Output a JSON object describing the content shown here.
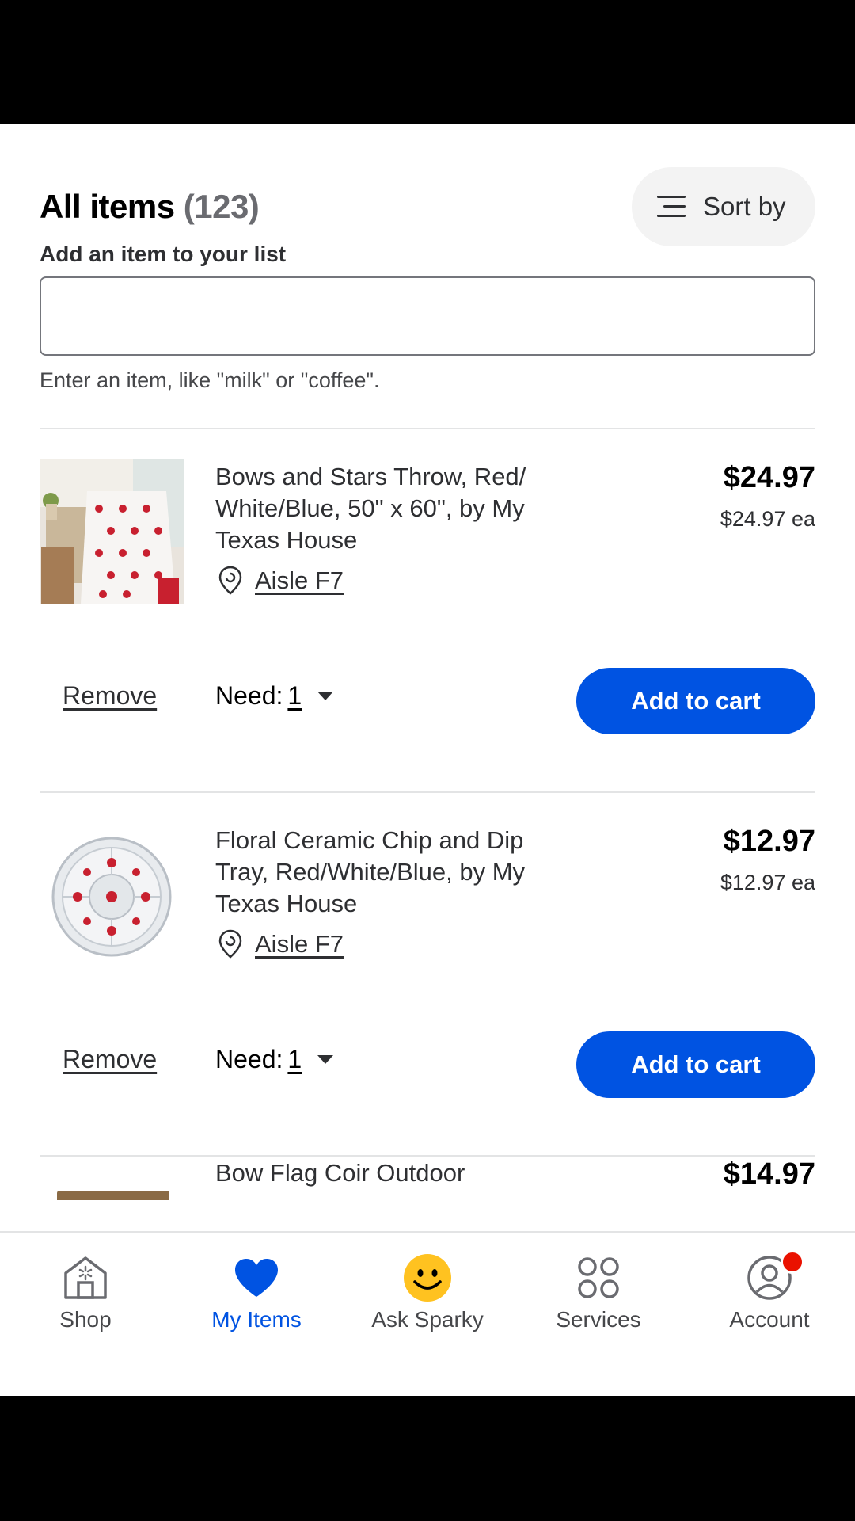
{
  "header": {
    "title": "All items",
    "count": "(123)",
    "sort_label": "Sort by"
  },
  "add_item": {
    "label": "Add an item to your list",
    "value": "",
    "hint": "Enter an item, like \"milk\" or \"coffee\"."
  },
  "items": [
    {
      "name": "Bows and Stars Throw, Red/ White/Blue, 50\" x 60\", by My Texas House",
      "price": "$24.97",
      "unit_price": "$24.97 ea",
      "aisle": "Aisle F7",
      "remove_label": "Remove",
      "need_label": "Need:",
      "need_qty": "1",
      "cart_label": "Add to cart"
    },
    {
      "name": "Floral Ceramic Chip and Dip Tray, Red/White/Blue, by My Texas House",
      "price": "$12.97",
      "unit_price": "$12.97 ea",
      "aisle": "Aisle F7",
      "remove_label": "Remove",
      "need_label": "Need:",
      "need_qty": "1",
      "cart_label": "Add to cart"
    },
    {
      "name": "Bow Flag Coir Outdoor",
      "price": "$14.97"
    }
  ],
  "nav": {
    "tabs": [
      {
        "label": "Shop",
        "icon": "store-icon"
      },
      {
        "label": "My Items",
        "icon": "heart-icon"
      },
      {
        "label": "Ask Sparky",
        "icon": "smiley-icon"
      },
      {
        "label": "Services",
        "icon": "grid-circles-icon"
      },
      {
        "label": "Account",
        "icon": "account-icon"
      }
    ],
    "active": "My Items"
  },
  "colors": {
    "accent": "#0053e2",
    "badge": "#ea1100",
    "sparky": "#ffc220"
  }
}
